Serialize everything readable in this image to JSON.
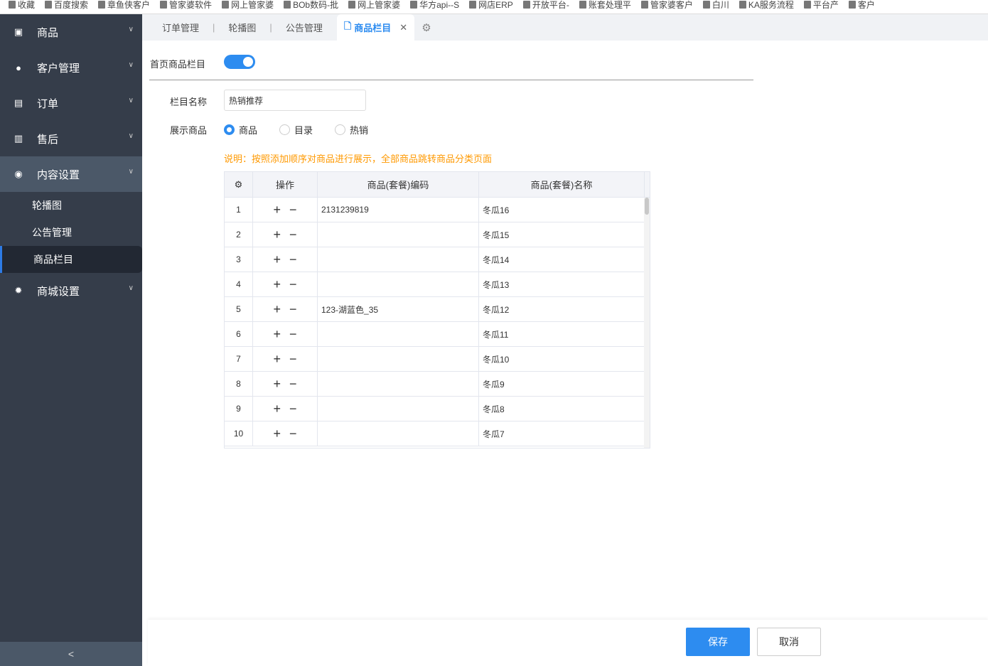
{
  "bookmarks": [
    "收藏",
    "百度搜索",
    "章鱼侠客户",
    "管家婆软件",
    "网上管家婆",
    "BOb数码-批",
    "网上管家婆",
    "华方api--S",
    "网店ERP",
    "开放平台-",
    "账套处理平",
    "管家婆客户",
    "白川",
    "KA服务流程",
    "平台产",
    "客户"
  ],
  "sidebar": {
    "items": [
      {
        "label": "商品"
      },
      {
        "label": "客户管理"
      },
      {
        "label": "订单"
      },
      {
        "label": "售后"
      },
      {
        "label": "内容设置"
      },
      {
        "label": "商城设置"
      }
    ],
    "sub": [
      {
        "label": "轮播图"
      },
      {
        "label": "公告管理"
      },
      {
        "label": "商品栏目"
      }
    ],
    "collapse": "<"
  },
  "tabs": [
    {
      "label": "订单管理"
    },
    {
      "label": "轮播图"
    },
    {
      "label": "公告管理"
    },
    {
      "label": "商品栏目"
    }
  ],
  "form": {
    "toggle_label": "首页商品栏目",
    "toggle_on": true,
    "name_label": "栏目名称",
    "name_value": "热销推荐",
    "show_label": "展示商品",
    "radios": [
      {
        "label": "商品",
        "checked": true
      },
      {
        "label": "目录"
      },
      {
        "label": "热销"
      }
    ],
    "note": "说明：按照添加顺序对商品进行展示，全部商品跳转商品分类页面"
  },
  "table": {
    "headers": [
      "操作",
      "商品(套餐)编码",
      "商品(套餐)名称"
    ],
    "rows": [
      {
        "n": "1",
        "code": "2131239819",
        "name": "冬瓜16"
      },
      {
        "n": "2",
        "code": "",
        "name": "冬瓜15"
      },
      {
        "n": "3",
        "code": "",
        "name": "冬瓜14"
      },
      {
        "n": "4",
        "code": "",
        "name": "冬瓜13"
      },
      {
        "n": "5",
        "code": "123-湖蓝色_35",
        "name": "冬瓜12"
      },
      {
        "n": "6",
        "code": "",
        "name": "冬瓜11"
      },
      {
        "n": "7",
        "code": "",
        "name": "冬瓜10"
      },
      {
        "n": "8",
        "code": "",
        "name": "冬瓜9"
      },
      {
        "n": "9",
        "code": "",
        "name": "冬瓜8"
      },
      {
        "n": "10",
        "code": "",
        "name": "冬瓜7"
      }
    ]
  },
  "buttons": {
    "save": "保存",
    "cancel": "取消"
  }
}
